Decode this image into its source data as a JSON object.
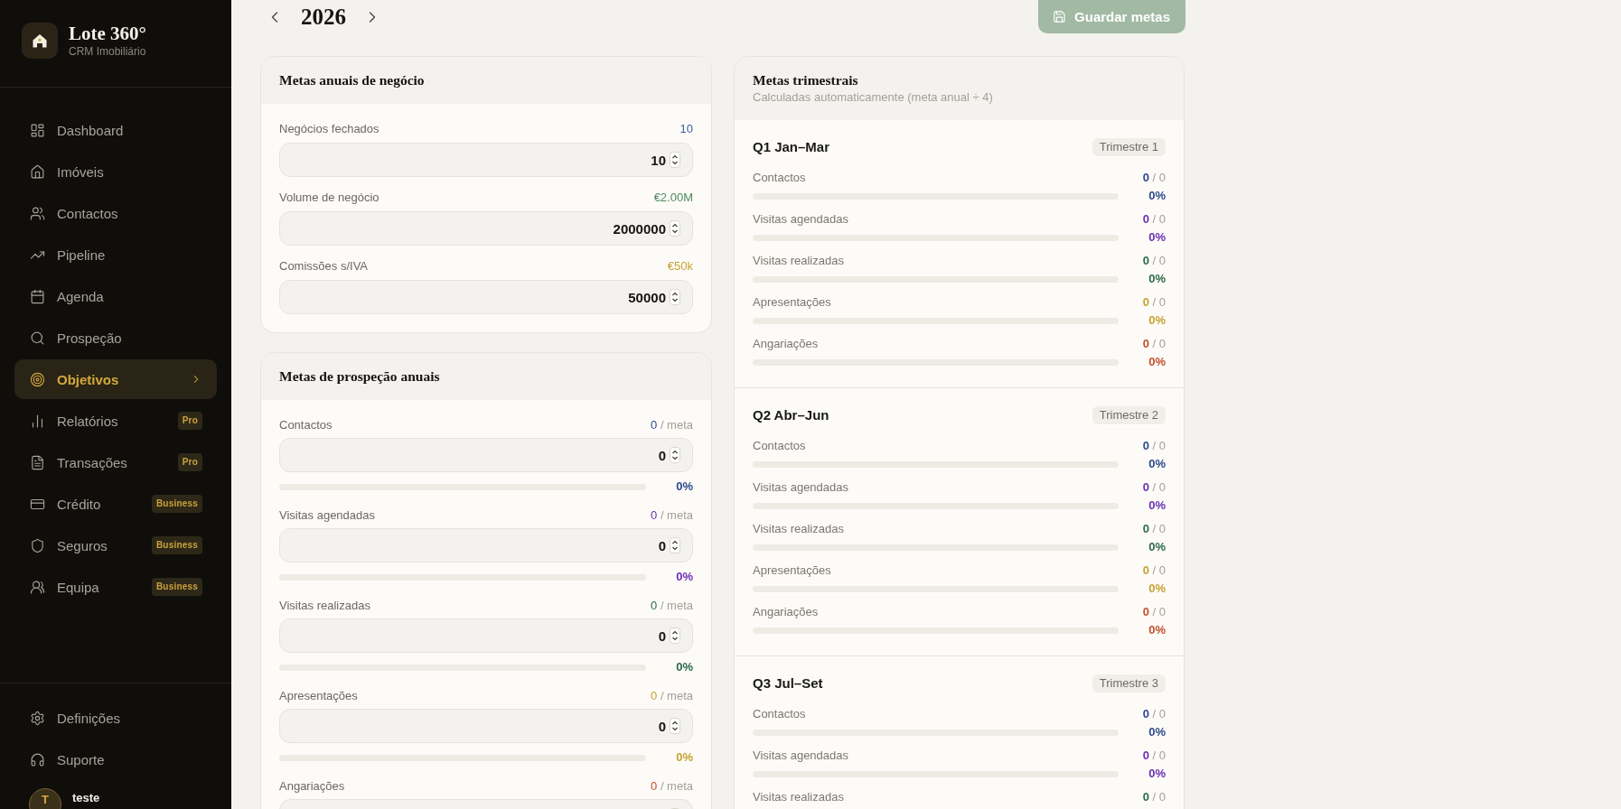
{
  "sidebar": {
    "brand": {
      "title": "Lote 360°",
      "subtitle": "CRM Imobiliário"
    },
    "nav": [
      {
        "label": "Dashboard",
        "selected": false
      },
      {
        "label": "Imóveis",
        "selected": false
      },
      {
        "label": "Contactos",
        "selected": false
      },
      {
        "label": "Pipeline",
        "selected": false
      },
      {
        "label": "Agenda",
        "selected": false
      },
      {
        "label": "Prospeção",
        "selected": false
      },
      {
        "label": "Objetivos",
        "selected": true
      },
      {
        "label": "Relatórios",
        "selected": false,
        "badge": "Pro"
      },
      {
        "label": "Transações",
        "selected": false,
        "badge": "Pro"
      },
      {
        "label": "Crédito",
        "selected": false,
        "badge": "Business"
      },
      {
        "label": "Seguros",
        "selected": false,
        "badge": "Business"
      },
      {
        "label": "Equipa",
        "selected": false,
        "badge": "Business"
      }
    ],
    "footer_nav": [
      {
        "label": "Definições",
        "selected": false
      },
      {
        "label": "Suporte",
        "selected": false
      }
    ],
    "user": {
      "initial": "T",
      "name": "teste"
    }
  },
  "year_nav": {
    "year": "2026"
  },
  "save_button": {
    "label": "Guardar metas"
  },
  "annual_business_goals": {
    "title": "Metas anuais de negócio",
    "fields": [
      {
        "label": "Negócios fechados",
        "summary": "10",
        "value": "10",
        "color": "#3d5da3"
      },
      {
        "label": "Volume de negócio",
        "summary": "€2.00M",
        "value": "2000000",
        "color": "#4f8a5f"
      },
      {
        "label": "Comissões s/IVA",
        "summary": "€50k",
        "value": "50000",
        "color": "#c9a232"
      }
    ]
  },
  "annual_prospecting_goals": {
    "title": "Metas de prospeção anuais",
    "fields": [
      {
        "label": "Contactos",
        "current": "0",
        "target": "/ meta",
        "value": "0",
        "level": 0,
        "percent": "0%",
        "color": "#2e4a8f"
      },
      {
        "label": "Visitas agendadas",
        "current": "0",
        "target": "/ meta",
        "value": "0",
        "level": 0,
        "percent": "0%",
        "color": "#6b2fb3"
      },
      {
        "label": "Visitas realizadas",
        "current": "0",
        "target": "/ meta",
        "value": "0",
        "level": 0,
        "percent": "0%",
        "color": "#2f6a47"
      },
      {
        "label": "Apresentações",
        "current": "0",
        "target": "/ meta",
        "value": "0",
        "level": 0,
        "percent": "0%",
        "color": "#c9a232"
      },
      {
        "label": "Angariações",
        "current": "0",
        "target": "/ meta",
        "color": "#c4502c"
      }
    ]
  },
  "quarterly_goals": {
    "title": "Metas trimestrais",
    "subtitle": "Calculadas automaticamente (meta anual ÷ 4)",
    "quarters": [
      {
        "title": "Q1 Jan–Mar",
        "badge": "Trimestre 1",
        "metrics": [
          {
            "label": "Contactos",
            "current": "0",
            "target": "/ 0",
            "level": 0,
            "percent": "0%",
            "color": "#2e4a8f"
          },
          {
            "label": "Visitas agendadas",
            "current": "0",
            "target": "/ 0",
            "level": 0,
            "percent": "0%",
            "color": "#6b2fb3"
          },
          {
            "label": "Visitas realizadas",
            "current": "0",
            "target": "/ 0",
            "level": 0,
            "percent": "0%",
            "color": "#2f6a47"
          },
          {
            "label": "Apresentações",
            "current": "0",
            "target": "/ 0",
            "level": 0,
            "percent": "0%",
            "color": "#c9a232"
          },
          {
            "label": "Angariações",
            "current": "0",
            "target": "/ 0",
            "level": 0,
            "percent": "0%",
            "color": "#c4502c"
          }
        ]
      },
      {
        "title": "Q2 Abr–Jun",
        "badge": "Trimestre 2",
        "metrics": [
          {
            "label": "Contactos",
            "current": "0",
            "target": "/ 0",
            "level": 0,
            "percent": "0%",
            "color": "#2e4a8f"
          },
          {
            "label": "Visitas agendadas",
            "current": "0",
            "target": "/ 0",
            "level": 0,
            "percent": "0%",
            "color": "#6b2fb3"
          },
          {
            "label": "Visitas realizadas",
            "current": "0",
            "target": "/ 0",
            "level": 0,
            "percent": "0%",
            "color": "#2f6a47"
          },
          {
            "label": "Apresentações",
            "current": "0",
            "target": "/ 0",
            "level": 0,
            "percent": "0%",
            "color": "#c9a232"
          },
          {
            "label": "Angariações",
            "current": "0",
            "target": "/ 0",
            "level": 0,
            "percent": "0%",
            "color": "#c4502c"
          }
        ]
      },
      {
        "title": "Q3 Jul–Set",
        "badge": "Trimestre 3",
        "metrics": [
          {
            "label": "Contactos",
            "current": "0",
            "target": "/ 0",
            "level": 0,
            "percent": "0%",
            "color": "#2e4a8f"
          },
          {
            "label": "Visitas agendadas",
            "current": "0",
            "target": "/ 0",
            "level": 0,
            "percent": "0%",
            "color": "#6b2fb3"
          },
          {
            "label": "Visitas realizadas",
            "current": "0",
            "target": "/ 0",
            "color": "#2f6a47"
          }
        ]
      }
    ]
  }
}
